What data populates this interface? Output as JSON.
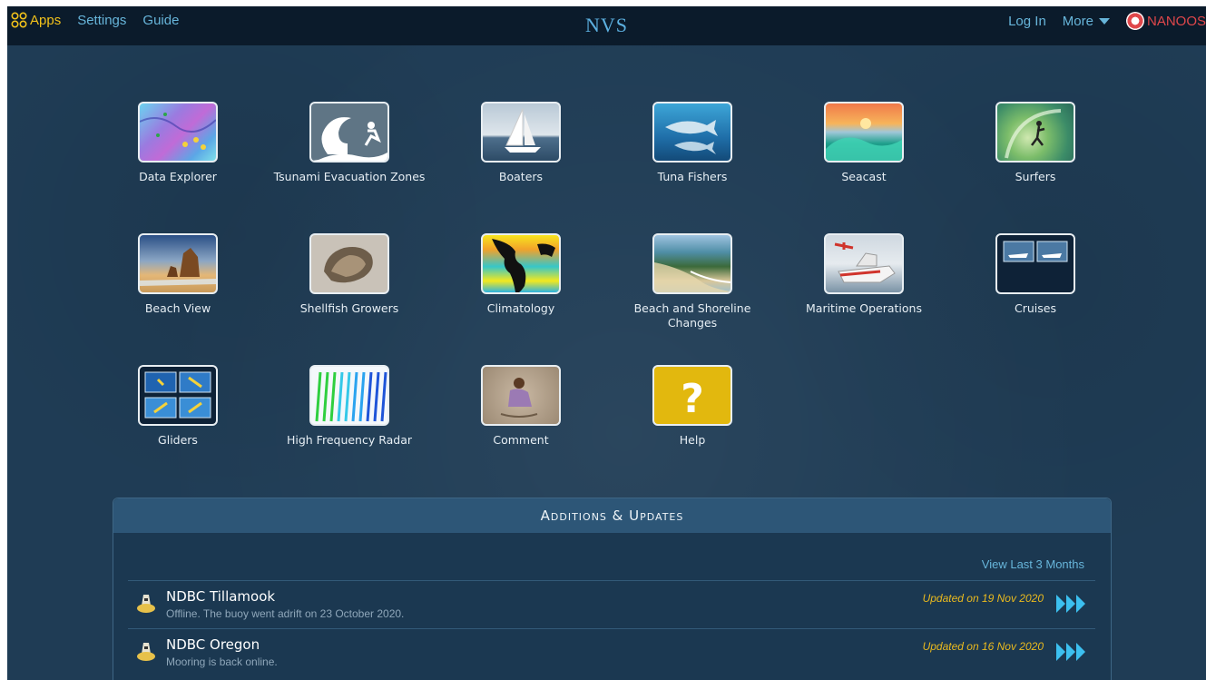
{
  "nav": {
    "apps": "Apps",
    "settings": "Settings",
    "guide": "Guide",
    "brand": "NVS",
    "login": "Log In",
    "more": "More",
    "org": "NANOOS"
  },
  "apps": [
    {
      "label": "Data Explorer",
      "icon": "data-explorer-thumbnail"
    },
    {
      "label": "Tsunami Evacuation Zones",
      "icon": "tsunami-thumbnail"
    },
    {
      "label": "Boaters",
      "icon": "sailboat-thumbnail"
    },
    {
      "label": "Tuna Fishers",
      "icon": "tuna-thumbnail"
    },
    {
      "label": "Seacast",
      "icon": "sunset-wave-thumbnail"
    },
    {
      "label": "Surfers",
      "icon": "surfer-thumbnail"
    },
    {
      "label": "Beach View",
      "icon": "beach-rocks-thumbnail"
    },
    {
      "label": "Shellfish Growers",
      "icon": "oyster-thumbnail"
    },
    {
      "label": "Climatology",
      "icon": "climate-map-thumbnail"
    },
    {
      "label": "Beach and Shoreline Changes",
      "icon": "coastline-thumbnail"
    },
    {
      "label": "Maritime Operations",
      "icon": "coast-guard-boat-thumbnail"
    },
    {
      "label": "Cruises",
      "icon": "cruise-ships-thumbnail"
    },
    {
      "label": "Gliders",
      "icon": "glider-grid-thumbnail"
    },
    {
      "label": "High Frequency Radar",
      "icon": "radar-vectors-thumbnail"
    },
    {
      "label": "Comment",
      "icon": "person-writing-thumbnail"
    },
    {
      "label": "Help",
      "icon": "question-mark-thumbnail"
    }
  ],
  "updates": {
    "heading": "Additions & Updates",
    "view_last": "View Last 3 Months",
    "items": [
      {
        "title": "NDBC Tillamook",
        "desc": "Offline. The buoy went adrift on 23 October 2020.",
        "date": "Updated on 19 Nov 2020"
      },
      {
        "title": "NDBC Oregon",
        "desc": "Mooring is back online.",
        "date": "Updated on 16 Nov 2020"
      }
    ]
  },
  "colors": {
    "background": "#1f3c55",
    "topbar": "#0b1b2b",
    "accent_link": "#67b5da",
    "apps_yellow": "#f2c21b",
    "date_gold": "#e9b91e",
    "arrow_cyan": "#3cc0f0"
  }
}
